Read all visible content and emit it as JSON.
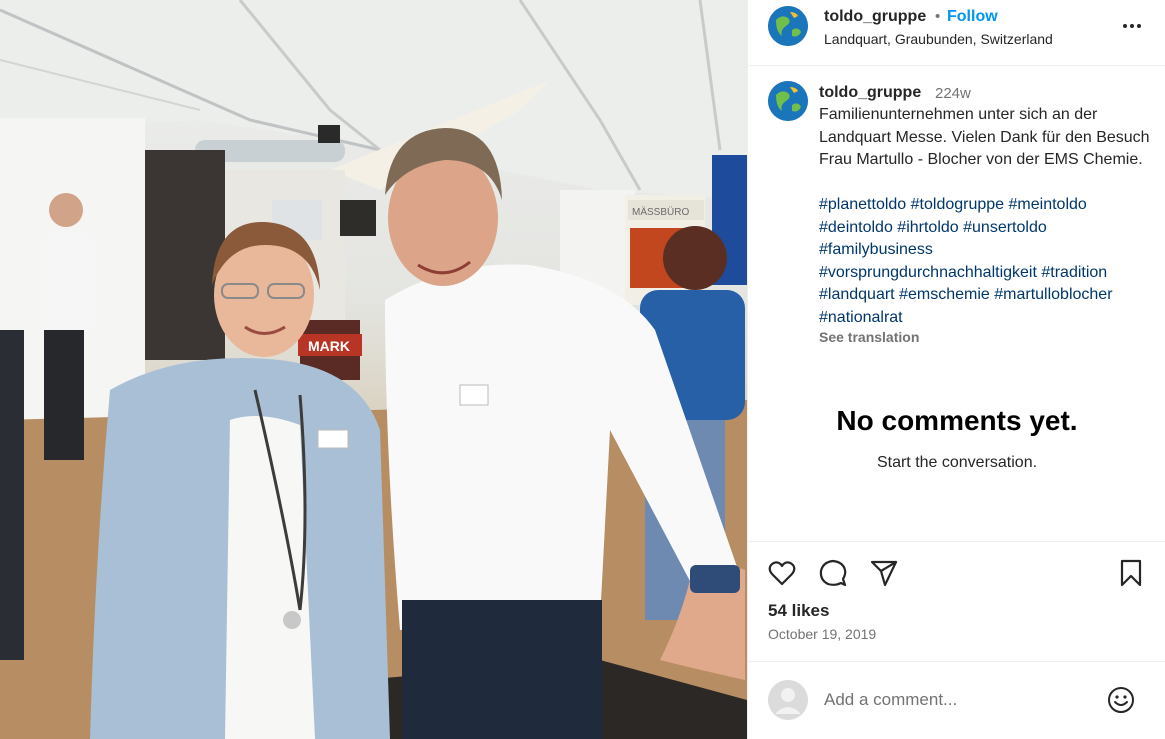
{
  "account": {
    "username": "toldo_gruppe",
    "follow_label": "Follow",
    "separator": "•",
    "location": "Landquart, Graubunden, Switzerland",
    "avatar_icon": "globe-logo-icon"
  },
  "caption": {
    "username": "toldo_gruppe",
    "time_ago": "224w",
    "text": "Familienunternehmen unter sich an der Landquart Messe. Vielen Dank für den Besuch Frau Martullo - Blocher von der EMS Chemie.",
    "hashtags": [
      "#planettoldo",
      "#toldogruppe",
      "#meintoldo",
      "#deintoldo",
      "#ihrtoldo",
      "#unsertoldo",
      "#familybusiness",
      "#vorsprungdurchnachhaltigkeit",
      "#tradition",
      "#landquart",
      "#emschemie",
      "#martulloblocher",
      "#nationalrat"
    ],
    "see_translation": "See translation"
  },
  "comments": {
    "empty_title": "No comments yet.",
    "empty_subtitle": "Start the conversation."
  },
  "actions": {
    "icons": [
      "heart-icon",
      "comment-icon",
      "share-icon",
      "bookmark-icon"
    ],
    "likes": "54 likes",
    "date": "October 19, 2019"
  },
  "comment_box": {
    "placeholder": "Add a comment...",
    "emoji_icon": "emoji-icon"
  },
  "photo_signs": {
    "booth_sign": "MÄSSBÜRO",
    "counter_sign": "MARK"
  },
  "colors": {
    "link_blue": "#0095f6",
    "hashtag_blue": "#00376b",
    "secondary_text": "#737373",
    "border": "#efefef"
  }
}
